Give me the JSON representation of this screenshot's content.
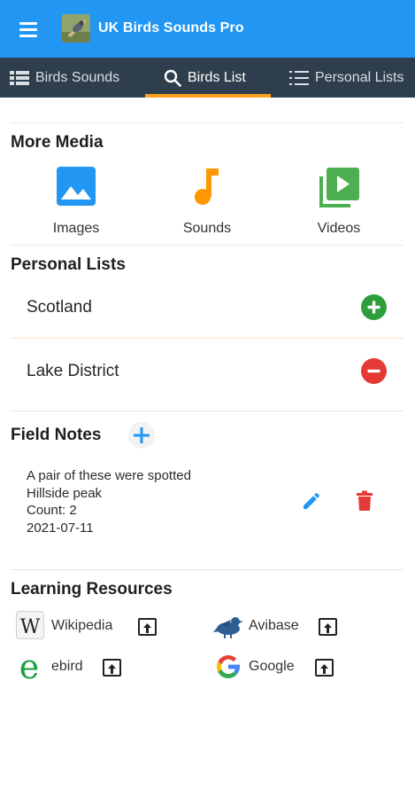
{
  "app": {
    "title": "UK Birds Sounds Pro",
    "accent_color": "#2196f3",
    "tabbar_color": "#2f3e4c",
    "tab_indicator_color": "#ff9f1a"
  },
  "tabs": [
    {
      "label": "Birds Sounds",
      "icon": "list-grid-icon",
      "active": false
    },
    {
      "label": "Birds List",
      "icon": "search-icon",
      "active": true
    },
    {
      "label": "Personal Lists",
      "icon": "numbered-list-icon",
      "active": false
    }
  ],
  "more_media": {
    "title": "More Media",
    "items": [
      {
        "label": "Images",
        "icon": "image-icon",
        "color": "#2196f3"
      },
      {
        "label": "Sounds",
        "icon": "music-note-icon",
        "color": "#ff9800"
      },
      {
        "label": "Videos",
        "icon": "video-library-icon",
        "color": "#4caf50"
      }
    ]
  },
  "personal_lists": {
    "title": "Personal Lists",
    "items": [
      {
        "name": "Scotland",
        "action": "add-circle-icon",
        "color": "#2e9e3a"
      },
      {
        "name": "Lake District",
        "action": "remove-circle-icon",
        "color": "#e53935"
      }
    ]
  },
  "field_notes": {
    "title": "Field Notes",
    "notes": [
      {
        "text": "A pair of these were spotted",
        "location": "Hillside peak",
        "count": "Count: 2",
        "date": "2021-07-11"
      }
    ],
    "edit_color": "#2196f3",
    "delete_color": "#e53935"
  },
  "learning_resources": {
    "title": "Learning Resources",
    "items": [
      {
        "label": "Wikipedia",
        "icon": "wikipedia-icon"
      },
      {
        "label": "Avibase",
        "icon": "avibase-bird-icon"
      },
      {
        "label": "ebird",
        "icon": "ebird-icon"
      },
      {
        "label": "Google",
        "icon": "google-icon"
      }
    ]
  }
}
